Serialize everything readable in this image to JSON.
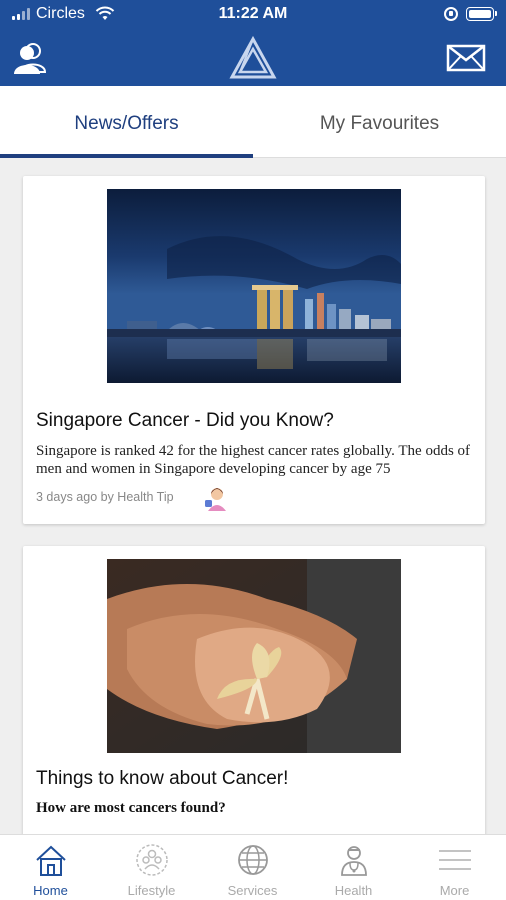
{
  "status_bar": {
    "carrier": "Circles",
    "time": "11:22 AM"
  },
  "header": {
    "profile_icon": "user-icon",
    "logo_icon": "triangle-logo-icon",
    "mail_icon": "mail-icon"
  },
  "tabs": [
    {
      "label": "News/Offers",
      "active": true
    },
    {
      "label": "My Favourites",
      "active": false
    }
  ],
  "cards": [
    {
      "image": "singapore-skyline-night-image",
      "title": "Singapore Cancer - Did you Know?",
      "body": "Singapore is ranked 42 for the highest cancer rates globally. The odds of men and women in Singapore developing cancer by age 75",
      "meta": "3 days ago by Health  Tip"
    },
    {
      "image": "hands-holding-ribbon-image",
      "title": "Things to know about Cancer!",
      "subtitle": "How are most cancers found?"
    }
  ],
  "bottom_nav": [
    {
      "label": "Home",
      "icon": "home-icon",
      "active": true
    },
    {
      "label": "Lifestyle",
      "icon": "lifestyle-icon",
      "active": false
    },
    {
      "label": "Services",
      "icon": "globe-icon",
      "active": false
    },
    {
      "label": "Health",
      "icon": "doctor-icon",
      "active": false
    },
    {
      "label": "More",
      "icon": "menu-icon",
      "active": false
    }
  ],
  "colors": {
    "brand": "#1f4f9a",
    "tab_active": "#1f3f7f",
    "nav_inactive": "#aaaaaa"
  }
}
